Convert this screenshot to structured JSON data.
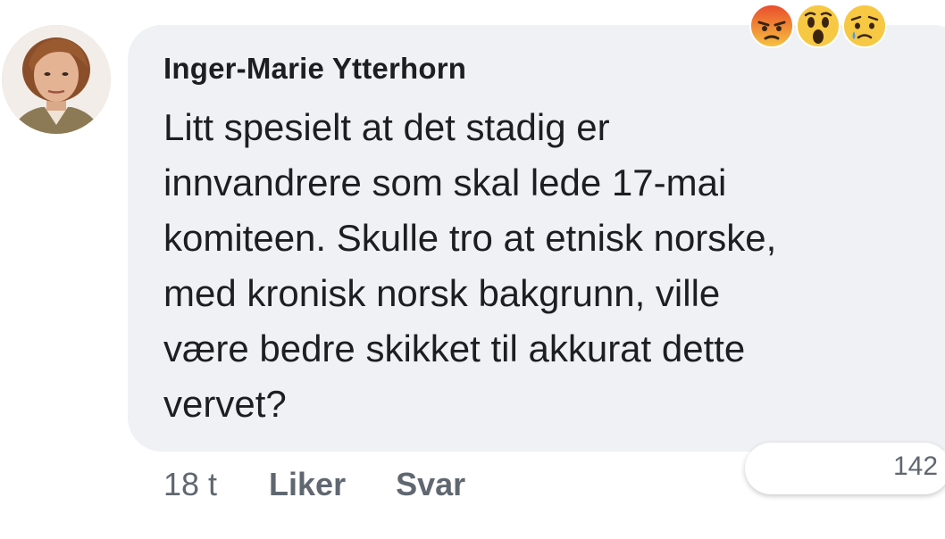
{
  "comment": {
    "author": "Inger-Marie Ytterhorn",
    "avatar_icon": "profile-photo",
    "text_lines": [
      "Litt spesielt at det stadig er",
      "innvandrere som skal lede 17-mai",
      "komiteen. Skulle tro at etnisk norske,",
      "med kronisk norsk bakgrunn, ville",
      "være bedre skikket til akkurat dette",
      "vervet?"
    ],
    "timestamp": "18 t",
    "like_label": "Liker",
    "reply_label": "Svar",
    "reactions": {
      "icons": [
        "angry-reaction-icon",
        "wow-reaction-icon",
        "sad-reaction-icon"
      ],
      "count": "142"
    }
  },
  "colors": {
    "bubble": "#f0f1f4",
    "text": "#1c1e21",
    "secondary_text": "#606770",
    "angry": "#e9710f",
    "emoji_yellow": "#f7c843"
  }
}
